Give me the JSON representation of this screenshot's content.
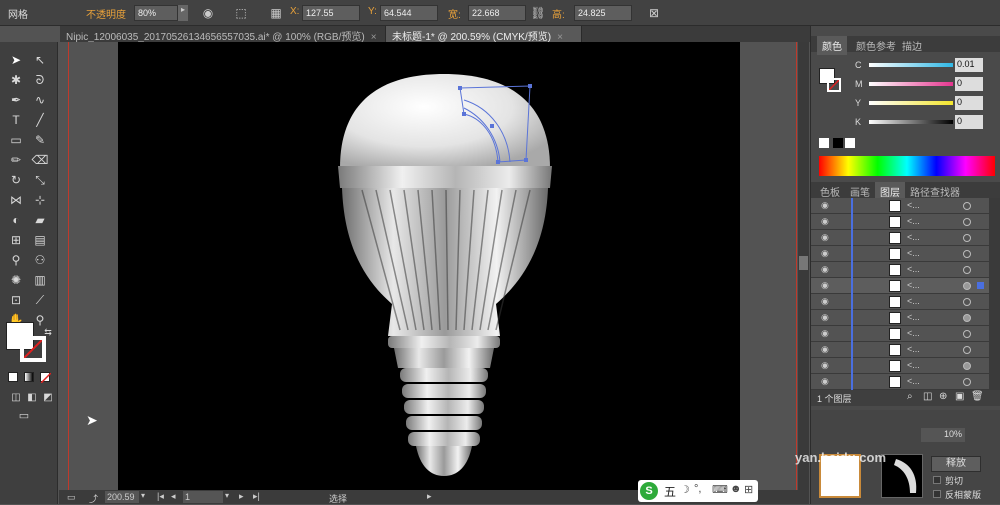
{
  "topbar": {
    "mode_label": "网格",
    "opacity_label": "不透明度",
    "opacity_value": "80%",
    "x_label": "X:",
    "x_value": "127.55",
    "y_label": "Y:",
    "y_value": "64.544",
    "w_label": "宽:",
    "w_value": "22.668",
    "h_label": "高:",
    "h_value": "24.825"
  },
  "tabs": [
    {
      "label": "Nipic_12006035_20170526134656557035.ai* @ 100% (RGB/预览)"
    },
    {
      "label": "未标题-1* @ 200.59% (CMYK/预览)"
    }
  ],
  "color_panel": {
    "tabs": [
      "颜色",
      "颜色参考",
      "描边"
    ],
    "channels": [
      {
        "name": "C",
        "value": "0.01",
        "color": "#4fc3e8"
      },
      {
        "name": "M",
        "value": "0",
        "color": "#e8489a"
      },
      {
        "name": "Y",
        "value": "0",
        "color": "#f1e73a"
      },
      {
        "name": "K",
        "value": "0",
        "color": "#888888"
      }
    ]
  },
  "layers_panel": {
    "tabs": [
      "色板",
      "画笔",
      "图层",
      "路径查找器"
    ],
    "rows": [
      "<...",
      "<...",
      "<...",
      "<...",
      "<...",
      "<...",
      "<...",
      "<...",
      "<...",
      "<...",
      "<...",
      "<..."
    ],
    "footer": "1 个图层"
  },
  "transparency_panel": {
    "opacity_value": "10%",
    "release_label": "释放",
    "clip_label": "剪切",
    "invert_label": "反相蒙版"
  },
  "statusbar": {
    "zoom": "200.59",
    "page": "1",
    "tool": "选择"
  },
  "ime": {
    "label": "五"
  },
  "watermark": "yan.baidu.com"
}
